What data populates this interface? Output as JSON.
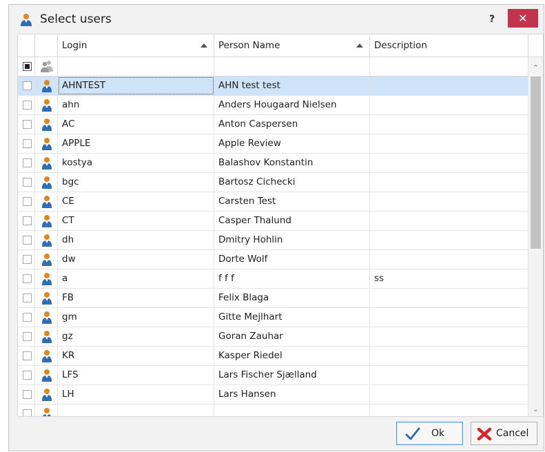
{
  "dialog": {
    "title": "Select users",
    "help_label": "?",
    "close_label": "✕"
  },
  "grid": {
    "columns": {
      "login": "Login",
      "person_name": "Person Name",
      "description": "Description"
    },
    "sort": {
      "login": "ascending",
      "person_name": "ascending"
    },
    "rows": [
      {
        "login": "AHNTEST",
        "person_name": "AHN test test",
        "description": "",
        "selected": true
      },
      {
        "login": "ahn",
        "person_name": "Anders Hougaard Nielsen",
        "description": ""
      },
      {
        "login": "AC",
        "person_name": "Anton Caspersen",
        "description": ""
      },
      {
        "login": "APPLE",
        "person_name": "Apple Review",
        "description": ""
      },
      {
        "login": "kostya",
        "person_name": "Balashov Konstantin",
        "description": ""
      },
      {
        "login": "bgc",
        "person_name": "Bartosz Cichecki",
        "description": ""
      },
      {
        "login": "CE",
        "person_name": "Carsten Test",
        "description": ""
      },
      {
        "login": "CT",
        "person_name": "Casper Thalund",
        "description": ""
      },
      {
        "login": "dh",
        "person_name": "Dmitry Hohlin",
        "description": ""
      },
      {
        "login": "dw",
        "person_name": "Dorte Wolf",
        "description": ""
      },
      {
        "login": "a",
        "person_name": "f f f",
        "description": "ss"
      },
      {
        "login": "FB",
        "person_name": "Felix Blaga",
        "description": ""
      },
      {
        "login": "gm",
        "person_name": "Gitte Mejlhart",
        "description": ""
      },
      {
        "login": "gz",
        "person_name": "Goran Zauhar",
        "description": ""
      },
      {
        "login": "KR",
        "person_name": "Kasper Riedel",
        "description": ""
      },
      {
        "login": "LFS",
        "person_name": "Lars Fischer Sjælland",
        "description": ""
      },
      {
        "login": "LH",
        "person_name": "Lars Hansen",
        "description": ""
      }
    ]
  },
  "buttons": {
    "ok": "Ok",
    "cancel": "Cancel"
  },
  "icons": {
    "title": "user-icon",
    "row": "user-icon",
    "filter_header": "user-group-icon",
    "ok": "checkmark-icon",
    "cancel": "red-x-icon"
  },
  "colors": {
    "close_button": "#c3334c",
    "selected_row": "#cfe4f8",
    "ok_border": "#5b9bd5",
    "user_icon_orange": "#e0861f",
    "user_icon_blue": "#2f6db5"
  }
}
